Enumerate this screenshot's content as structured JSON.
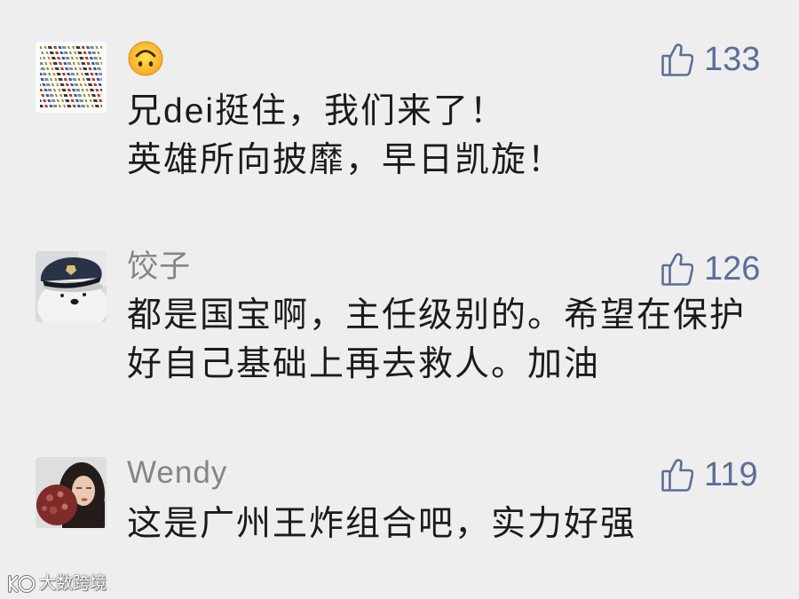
{
  "colors": {
    "background": "#eeeeee",
    "username": "#858585",
    "like": "#5b6e99",
    "text": "#1b1b1b",
    "watermark": "#ffffff"
  },
  "like_icon": "thumbs-up-icon",
  "comments": [
    {
      "avatar": "text-collage-avatar",
      "username_icon": "upside-down-face-emoji",
      "likes": "133",
      "lines": [
        "兄dei挺住，我们来了！",
        "英雄所向披靡，早日凯旋！"
      ]
    },
    {
      "avatar": "polar-bear-police-hat-avatar",
      "username": "饺子",
      "likes": "126",
      "lines": [
        "都是国宝啊，主任级别的。希望在保护",
        "好自己基础上再去救人。加油"
      ]
    },
    {
      "avatar": "woman-photo-avatar",
      "username": "Wendy",
      "likes": "119",
      "lines": [
        "这是广州王炸组合吧，实力好强"
      ]
    }
  ],
  "watermark": {
    "logo_icon": "watermark-logo-icon",
    "text": "大数跨境"
  }
}
